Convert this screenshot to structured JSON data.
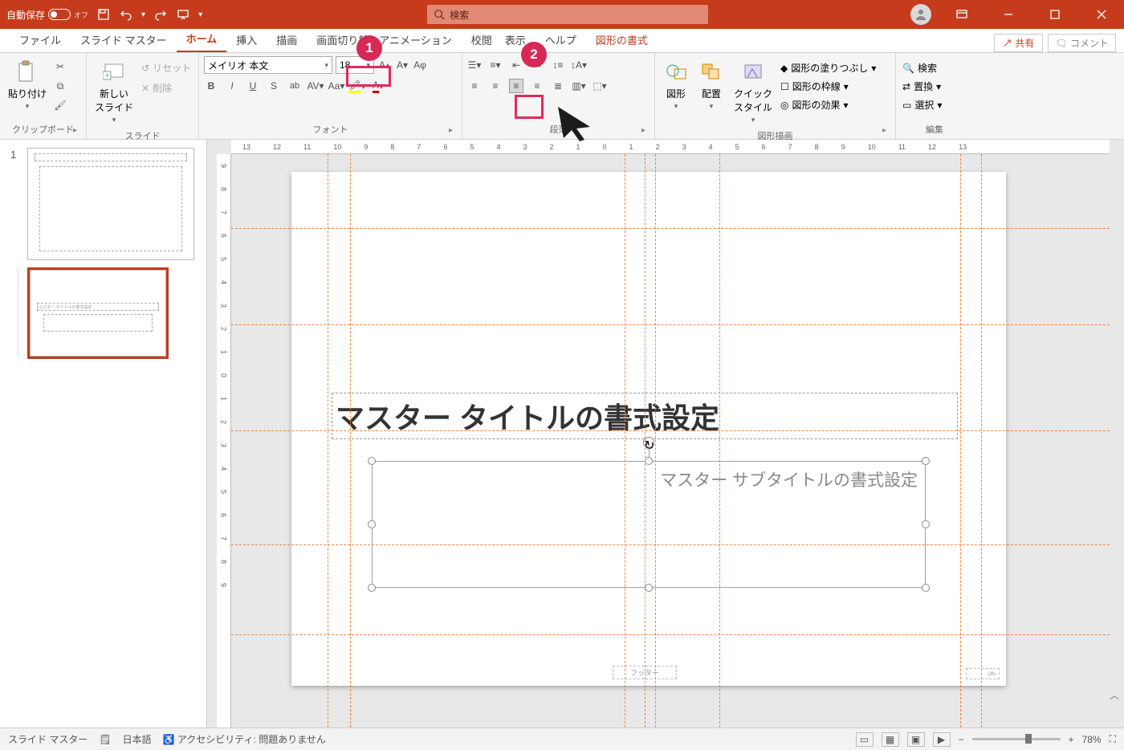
{
  "titlebar": {
    "autosave_label": "自動保存",
    "autosave_state": "オフ",
    "search_placeholder": "検索"
  },
  "tabs": {
    "file": "ファイル",
    "slide_master": "スライド マスター",
    "home": "ホーム",
    "insert": "挿入",
    "draw": "描画",
    "transitions": "画面切り替え",
    "animations": "アニメーション",
    "review": "校閲",
    "view": "表示",
    "help": "ヘルプ",
    "shape_format": "図形の書式",
    "share": "共有",
    "comments": "コメント"
  },
  "ribbon": {
    "clipboard": {
      "paste": "貼り付け",
      "group": "クリップボード"
    },
    "slides": {
      "new_slide": "新しい\nスライド",
      "reset": "リセット",
      "delete": "削除",
      "group": "スライド"
    },
    "font": {
      "name": "メイリオ 本文",
      "size": "18",
      "group": "フォント"
    },
    "paragraph": {
      "group": "段落"
    },
    "drawing": {
      "shapes": "図形",
      "arrange": "配置",
      "quick_styles": "クイック\nスタイル",
      "shape_fill": "図形の塗りつぶし",
      "shape_outline": "図形の枠線",
      "shape_effects": "図形の効果",
      "group": "図形描画"
    },
    "editing": {
      "find": "検索",
      "replace": "置換",
      "select": "選択",
      "group": "編集"
    }
  },
  "annotations": {
    "badge1": "1",
    "badge2": "2"
  },
  "thumbs": {
    "num1": "1"
  },
  "slide": {
    "title_placeholder": "マスター タイトルの書式設定",
    "subtitle_placeholder": "マスター サブタイトルの書式設定",
    "footer_label": "フッター",
    "pagenum_label": "‹#›"
  },
  "ruler": {
    "h": [
      "13",
      "12",
      "11",
      "10",
      "9",
      "8",
      "7",
      "6",
      "5",
      "4",
      "3",
      "2",
      "1",
      "0",
      "1",
      "2",
      "3",
      "4",
      "5",
      "6",
      "7",
      "8",
      "9",
      "10",
      "11",
      "12",
      "13"
    ],
    "v": [
      "9",
      "8",
      "7",
      "6",
      "5",
      "4",
      "3",
      "2",
      "1",
      "0",
      "1",
      "2",
      "3",
      "4",
      "5",
      "6",
      "7",
      "8",
      "9"
    ]
  },
  "status": {
    "mode": "スライド マスター",
    "lang": "日本語",
    "a11y": "アクセシビリティ: 問題ありません",
    "zoom": "78%"
  }
}
